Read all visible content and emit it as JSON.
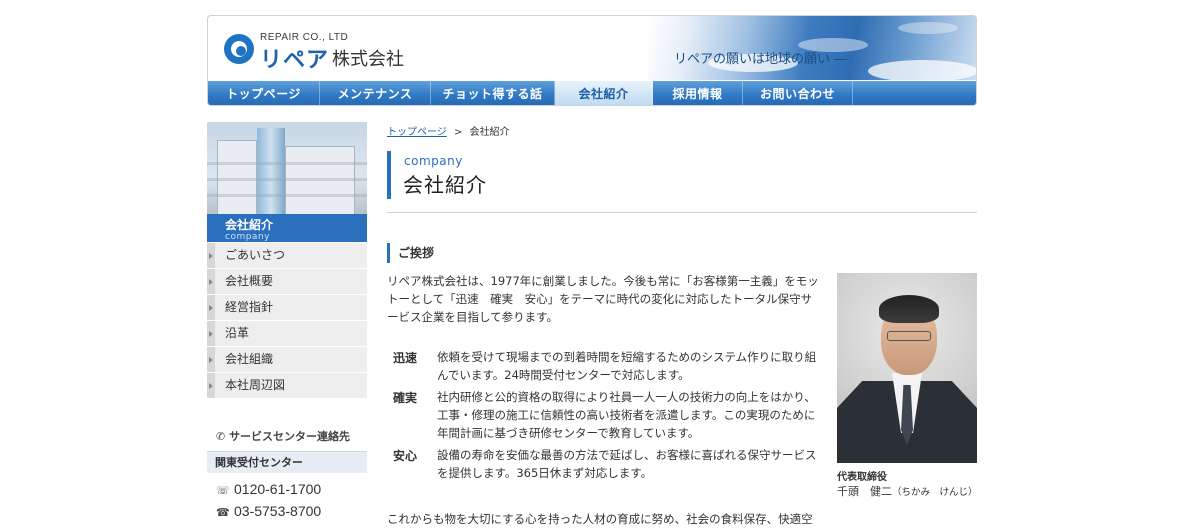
{
  "header": {
    "logo_en": "REPAIR CO., LTD",
    "logo_brand": "リペア",
    "logo_company": "株式会社",
    "tagline": "リペアの願いは地球の願い ―"
  },
  "nav": [
    {
      "label": "トップページ",
      "active": false
    },
    {
      "label": "メンテナンス",
      "active": false
    },
    {
      "label": "チョット得する話",
      "active": false
    },
    {
      "label": "会社紹介",
      "active": true
    },
    {
      "label": "採用情報",
      "active": false
    },
    {
      "label": "お問い合わせ",
      "active": false
    }
  ],
  "sidebar": {
    "heading": "会社紹介",
    "heading_en": "company",
    "items": [
      "ごあいさつ",
      "会社概要",
      "経営指針",
      "沿革",
      "会社組織",
      "本社周辺図"
    ],
    "service_title": "サービスセンター連絡先",
    "service_region": "関東受付センター",
    "phones": [
      {
        "icon": "free-dial-icon",
        "number": "0120-61-1700"
      },
      {
        "icon": "telephone-icon",
        "number": "03-5753-8700"
      }
    ]
  },
  "breadcrumb": {
    "home": "トップページ",
    "separator": ">",
    "current": "会社紹介"
  },
  "page_title": {
    "en": "company",
    "ja": "会社紹介"
  },
  "section": {
    "heading": "ご挨拶",
    "intro": "リペア株式会社は、1977年に創業しました。今後も常に「お客様第一主義」をモットーとして「迅速　確実　安心」をテーマに時代の変化に対応したトータル保守サービス企業を目指して参ります。",
    "values": [
      {
        "key": "迅速",
        "desc": "依頼を受けて現場までの到着時間を短縮するためのシステム作りに取り組んでいます。24時間受付センターで対応します。"
      },
      {
        "key": "確実",
        "desc": "社内研修と公的資格の取得により社員一人一人の技術力の向上をはかり、工事・修理の施工に信頼性の高い技術者を派遣します。この実現のために年間計画に基づき研修センターで教育しています。"
      },
      {
        "key": "安心",
        "desc": "設備の寿命を安価な最善の方法で延ばし、お客様に喜ばれる保守サービスを提供します。365日休まず対応します。"
      }
    ],
    "closing": "これからも物を大切にする心を持った人材の育成に努め、社会の食料保存、快適空"
  },
  "portrait": {
    "role": "代表取締役",
    "name": "千頭　健二",
    "reading": "（ちかみ　けんじ）"
  },
  "colors": {
    "accent": "#2b6fbf",
    "nav": "#2f78c3"
  }
}
